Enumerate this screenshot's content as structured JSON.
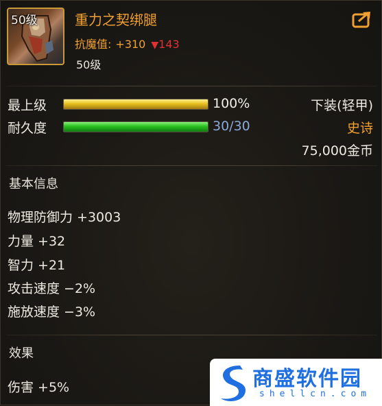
{
  "item": {
    "icon_level": "50级",
    "name": "重力之契绑腿",
    "resist_label": "抗魔值:",
    "resist_value": "+310",
    "resist_down": "143",
    "level": "50级"
  },
  "bars": [
    {
      "label": "最上级",
      "value_text": "100%",
      "fill": 1.0
    },
    {
      "label": "耐久度",
      "value_text": "30/30",
      "fill": 1.0
    }
  ],
  "slot_type": "下装(轻甲)",
  "rarity": "史诗",
  "price": "75,000金币",
  "base_info": {
    "title": "基本信息",
    "stats": [
      "物理防御力 +3003",
      "力量 +32",
      "智力 +21",
      "攻击速度 −2%",
      "施放速度 −3%"
    ]
  },
  "effects": {
    "title": "效果",
    "stats": [
      "伤害 +5%"
    ]
  },
  "watermark": {
    "title": "商盛软件园",
    "url": "shellcn.com"
  },
  "colors": {
    "epic_orange": "#f0a030",
    "down_red": "#e03030",
    "bar_gold": "#e8c020",
    "bar_green": "#28c020",
    "durability_blue": "#8aa8d8"
  },
  "icons": {
    "share": "share-arrow-icon",
    "down": "down-triangle-icon"
  }
}
